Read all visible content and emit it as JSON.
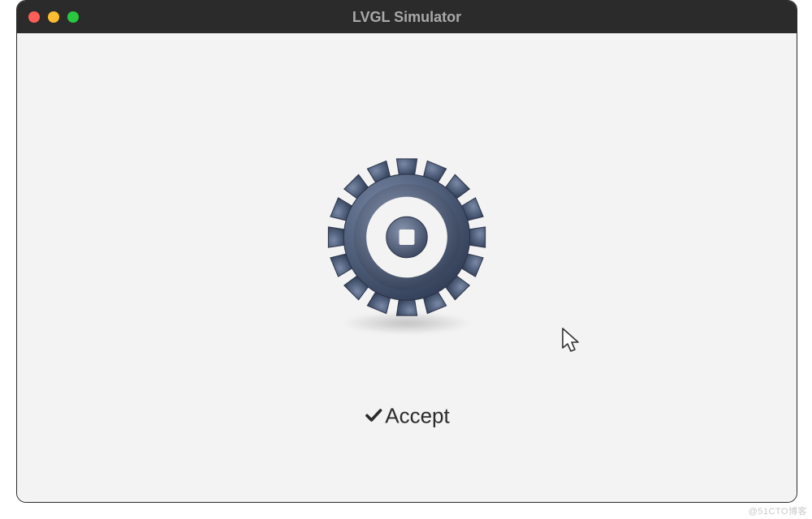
{
  "window": {
    "title": "LVGL Simulator"
  },
  "content": {
    "accept_label": "Accept"
  },
  "watermark": "@51CTO博客",
  "icons": {
    "gear": "gear-icon",
    "check": "check-icon",
    "cursor": "cursor-icon"
  },
  "colors": {
    "titlebar_bg": "#2b2b2b",
    "titlebar_text": "#a9a9a9",
    "content_bg": "#f3f3f3",
    "gear_dark": "#3a4860",
    "gear_light": "#5a6a8a",
    "traffic_close": "#ff5f57",
    "traffic_min": "#febc2e",
    "traffic_max": "#28c840"
  }
}
